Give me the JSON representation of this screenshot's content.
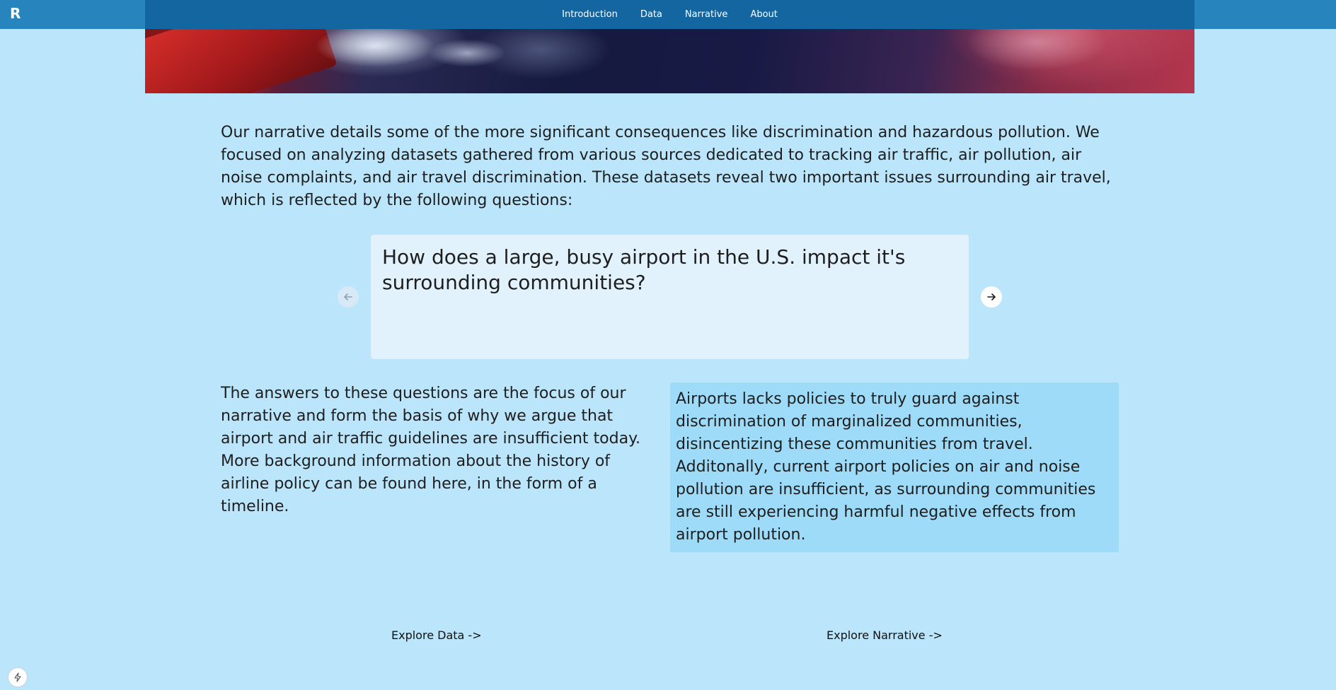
{
  "nav": {
    "logo": "R",
    "links": [
      "Introduction",
      "Data",
      "Narrative",
      "About"
    ]
  },
  "intro": {
    "text": "Our narrative details some of the more significant consequences like discrimination and hazardous pollution. We focused on analyzing datasets gathered from various sources dedicated to tracking air traffic, air pollution, air noise complaints, and air travel discrimination. These datasets reveal two important issues surrounding air travel, which is reflected by the following questions:"
  },
  "carousel": {
    "question": "How does a large, busy airport in the U.S. impact it's surrounding communities?",
    "prev_icon": "arrow-left-icon",
    "next_icon": "arrow-right-icon"
  },
  "answers": {
    "left_text": "The answers to these questions are the focus of our narrative and form the basis of why we argue that airport and air traffic guidelines are insufficient today. More background information about the history of airline policy can be found here, in the form of a timeline.",
    "right_text": "Airports lacks policies to truly guard against discrimination of marginalized communities, disincentizing these communities from travel. Additonally, current airport policies on air and noise pollution are insufficient, as surrounding communities are still experiencing harmful negative effects from airport pollution."
  },
  "explore": {
    "data_label": "Explore Data ->",
    "narrative_label": "Explore Narrative ->"
  },
  "colors": {
    "page_bg": "#bbe5fb",
    "nav_bg": "#2784bc",
    "nav_center_bg": "#1466a1",
    "card_bg": "#e1f2fd",
    "highlight_bg": "#9ddbf8"
  }
}
